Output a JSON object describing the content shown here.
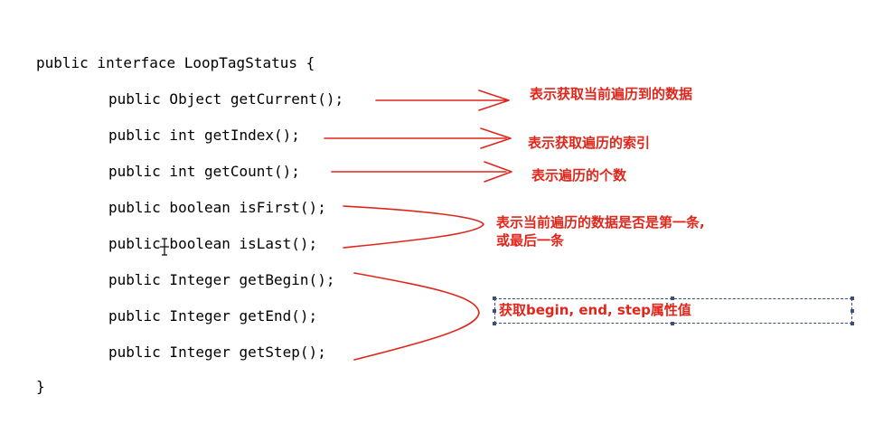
{
  "code": {
    "header": "public interface LoopTagStatus {",
    "methods": [
      "public Object getCurrent();",
      "public int getIndex();",
      "public int getCount();",
      "public boolean isFirst();",
      "public boolean isLast();",
      "public Integer getBegin();",
      "public Integer getEnd();",
      "public Integer getStep();"
    ],
    "footer": "}"
  },
  "annotations": {
    "current": "表示获取当前遍历到的数据",
    "index": "表示获取遍历的索引",
    "count": "表示遍历的个数",
    "first_last_line1": "表示当前遍历的数据是否是第一条,",
    "first_last_line2": "或最后一条",
    "begin_end_step": "获取begin, end, step属性值"
  },
  "colors": {
    "annotation": "#e0261b",
    "code": "#000000",
    "frame": "#3b4f7a"
  }
}
